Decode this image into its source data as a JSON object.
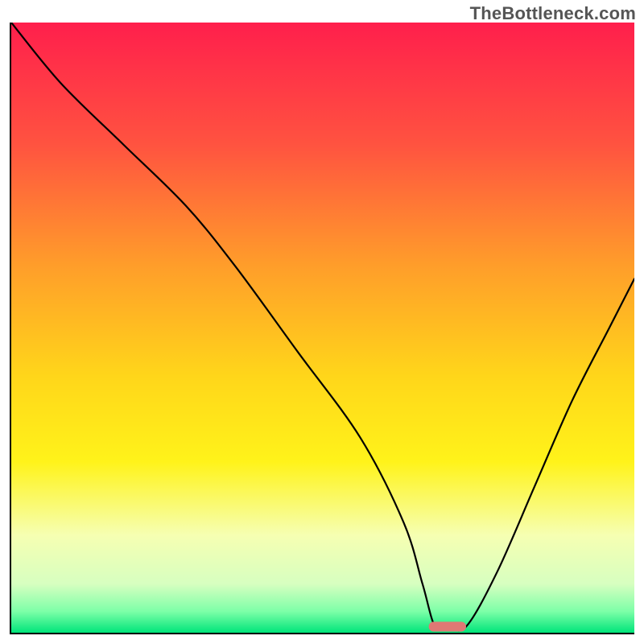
{
  "watermark": "TheBottleneck.com",
  "accent_marker_color": "#e07874",
  "chart_data": {
    "type": "line",
    "title": "",
    "xlabel": "",
    "ylabel": "",
    "xlim": [
      0,
      100
    ],
    "ylim": [
      0,
      100
    ],
    "background_gradient_stops": [
      {
        "offset": 0.0,
        "color": "#ff1f4c"
      },
      {
        "offset": 0.2,
        "color": "#ff5340"
      },
      {
        "offset": 0.4,
        "color": "#ff9e2a"
      },
      {
        "offset": 0.58,
        "color": "#ffd61a"
      },
      {
        "offset": 0.72,
        "color": "#fff31a"
      },
      {
        "offset": 0.84,
        "color": "#f6ffb2"
      },
      {
        "offset": 0.92,
        "color": "#d7ffc0"
      },
      {
        "offset": 0.965,
        "color": "#7dffa8"
      },
      {
        "offset": 1.0,
        "color": "#00e57a"
      }
    ],
    "series": [
      {
        "name": "bottleneck-curve",
        "x": [
          0,
          8,
          18,
          28,
          36,
          46,
          56,
          63,
          66,
          68,
          70,
          73,
          78,
          84,
          90,
          96,
          100
        ],
        "y": [
          100,
          90,
          80,
          70,
          60,
          46,
          32,
          18,
          8,
          1,
          1,
          1,
          10,
          24,
          38,
          50,
          58
        ]
      }
    ],
    "marker": {
      "name": "optimal-range-marker",
      "x_center": 70,
      "y": 1,
      "width_pct": 6,
      "height_pct": 1.6
    }
  }
}
